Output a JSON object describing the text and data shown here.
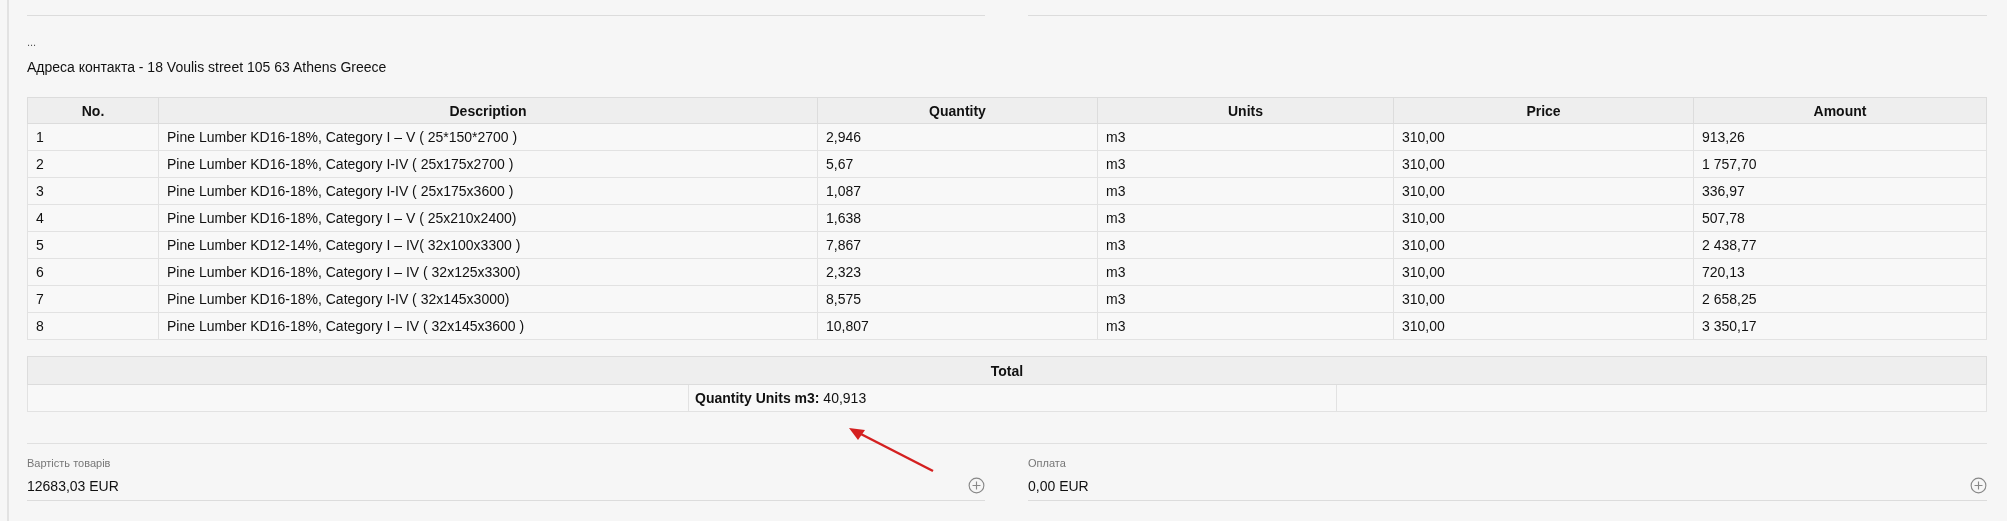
{
  "ellipsis": "...",
  "contact_address": "Адреса контакта - 18 Voulis street 105 63 Athens Greece",
  "table": {
    "columns": [
      "No.",
      "Description",
      "Quantity",
      "Units",
      "Price",
      "Amount"
    ],
    "rows": [
      [
        "1",
        "Pine Lumber KD16-18%, Category I – V ( 25*150*2700 )",
        "2,946",
        "m3",
        "310,00",
        "913,26"
      ],
      [
        "2",
        "Pine Lumber KD16-18%, Category I-IV ( 25x175x2700 )",
        "5,67",
        "m3",
        "310,00",
        "1 757,70"
      ],
      [
        "3",
        "Pine Lumber KD16-18%, Category I-IV ( 25x175x3600 )",
        "1,087",
        "m3",
        "310,00",
        "336,97"
      ],
      [
        "4",
        "Pine Lumber KD16-18%, Category I – V ( 25x210x2400)",
        "1,638",
        "m3",
        "310,00",
        "507,78"
      ],
      [
        "5",
        "Pine Lumber KD12-14%, Category I – IV( 32x100x3300 )",
        "7,867",
        "m3",
        "310,00",
        "2 438,77"
      ],
      [
        "6",
        "Pine Lumber KD16-18%, Category I – IV ( 32x125x3300)",
        "2,323",
        "m3",
        "310,00",
        "720,13"
      ],
      [
        "7",
        "Pine Lumber KD16-18%, Category I-IV ( 32x145x3000)",
        "8,575",
        "m3",
        "310,00",
        "2 658,25"
      ],
      [
        "8",
        "Pine Lumber KD16-18%, Category I – IV ( 32x145x3600 )",
        "10,807",
        "m3",
        "310,00",
        "3 350,17"
      ]
    ]
  },
  "total": {
    "title": "Total",
    "text": "**Quantity Units m3:** 40,913"
  },
  "fields": [
    {
      "label": "Вартість товарів",
      "value": "12683,03 EUR"
    },
    {
      "label": "Оплата",
      "value": "0,00 EUR"
    }
  ]
}
